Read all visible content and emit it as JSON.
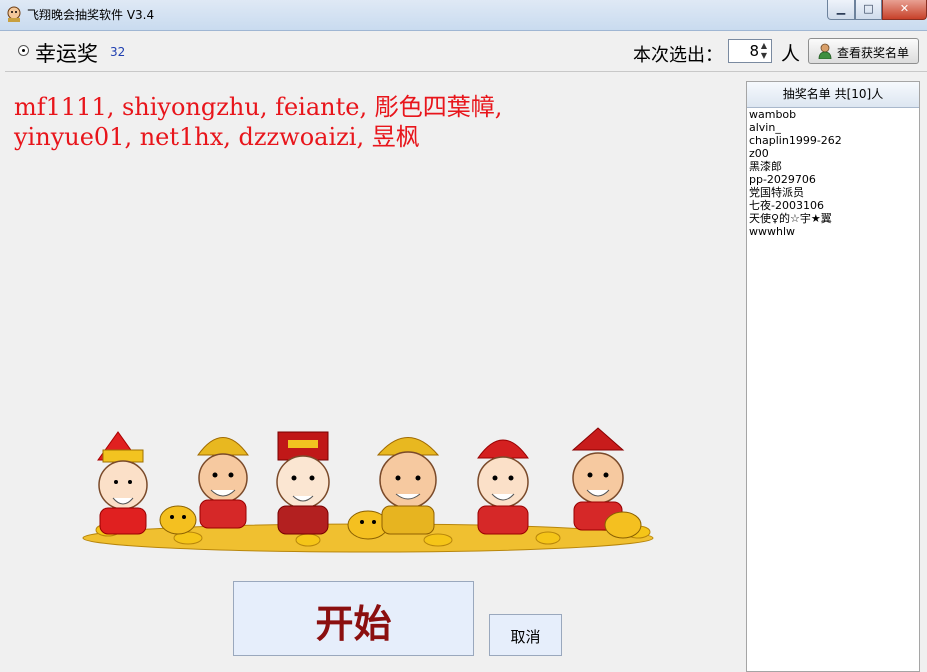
{
  "window": {
    "title": "飞翔晚会抽奖软件 V3.4",
    "controls": {
      "minimize": "▁",
      "maximize": "□",
      "close": "✕"
    }
  },
  "toolbar": {
    "prize_name": "幸运奖",
    "prize_count": "32",
    "select_label": "本次选出：",
    "select_value": "8",
    "unit_label": "人",
    "view_winners_label": "查看获奖名单"
  },
  "winners_text": "mf1111, shiyongzhu, feiante, 彫色四葉幛,\nyinyue01, net1hx, dzzwoaizi, 昱枫",
  "list": {
    "header": "抽奖名单 共[10]人",
    "items": [
      "wambob",
      "alvin_",
      "chaplin1999-262",
      "z00",
      "黑漆郎",
      "pp-2029706",
      "党国特派员",
      "七夜-2003106",
      "天使♀的☆宇★翼",
      "wwwhlw"
    ]
  },
  "buttons": {
    "start": "开始",
    "cancel": "取消"
  },
  "colors": {
    "winners_text": "#e8151b",
    "start_text": "#8b0f0f",
    "accent": "#1f3fb0"
  }
}
